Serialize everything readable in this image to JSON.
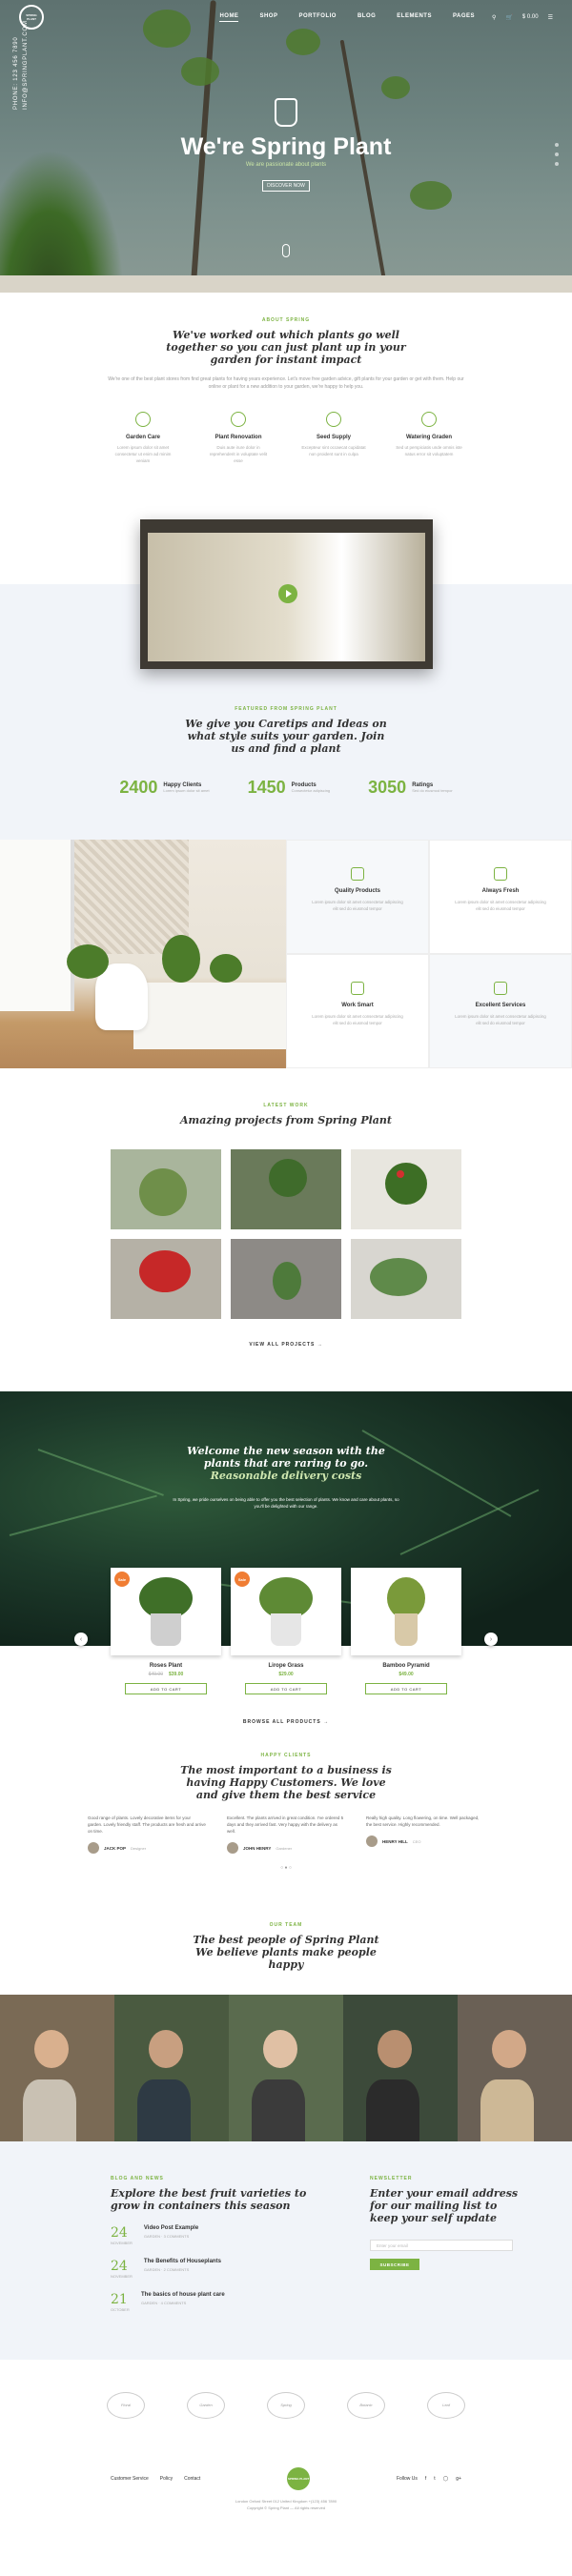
{
  "nav": {
    "logo": "SPRING PLANT",
    "menu": [
      "HOME",
      "SHOP",
      "PORTFOLIO",
      "BLOG",
      "ELEMENTS",
      "PAGES"
    ],
    "cart_label": "$ 0.00",
    "search": "search-icon"
  },
  "hero": {
    "side_phone": "PHONE: 123 456 7890",
    "side_email": "INFO@SPRINGPLANT.COM",
    "title": "We're Spring Plant",
    "subtitle": "We are passionate about plants",
    "button": "DISCOVER NOW"
  },
  "about": {
    "kicker": "ABOUT SPRING",
    "title_line1": "We've worked out which plants go well",
    "title_line2": "together so you can just plant up in your",
    "title_line3": "garden for instant impact",
    "para": "We're one of the best plant stores from find great plants for having years experience. Let's move free garden advice, gift plants for your garden or get with them. Help our online or plant for a new addition to your garden, we're happy to help you.",
    "features": [
      {
        "icon": "leaf-icon",
        "title": "Garden Care",
        "text": "Lorem ipsum dolor sit amet consectetur ut enim ad minim veniam"
      },
      {
        "icon": "plant-icon",
        "title": "Plant Renovation",
        "text": "Duis aute irure dolor in reprehenderit in voluptate velit esse"
      },
      {
        "icon": "seed-icon",
        "title": "Seed Supply",
        "text": "Excepteur sint occaecat cupidatat non proident sunt in culpa"
      },
      {
        "icon": "watering-icon",
        "title": "Watering Graden",
        "text": "Sed ut perspiciatis unde omnis iste natus error sit voluptatem"
      }
    ]
  },
  "stats": {
    "kicker": "FEATURED FROM SPRING PLANT",
    "title_line1": "We give you Caretips and Ideas on",
    "title_line2": "what style suits your garden. Join",
    "title_line3": "us and find a plant",
    "items": [
      {
        "number": "2400",
        "label": "Happy Clients",
        "sub": "Lorem ipsum dolor sit amet"
      },
      {
        "number": "1450",
        "label": "Products",
        "sub": "Consectetur adipiscing"
      },
      {
        "number": "3050",
        "label": "Ratings",
        "sub": "Sed do eiusmod tempor"
      }
    ]
  },
  "quality": [
    {
      "icon": "quality-icon",
      "title": "Quality Products",
      "text": "Lorem ipsum dolor sit amet consectetur adipiscing elit sed do eiusmod tempor"
    },
    {
      "icon": "always-fresh-icon",
      "title": "Always Fresh",
      "text": "Lorem ipsum dolor sit amet consectetur adipiscing elit sed do eiusmod tempor"
    },
    {
      "icon": "work-smart-icon",
      "title": "Work Smart",
      "text": "Lorem ipsum dolor sit amet consectetur adipiscing elit sed do eiusmod tempor"
    },
    {
      "icon": "services-icon",
      "title": "Excellent Services",
      "text": "Lorem ipsum dolor sit amet consectetur adipiscing elit sed do eiusmod tempor"
    }
  ],
  "projects": {
    "kicker": "LATEST WORK",
    "title": "Amazing projects from Spring Plant",
    "view_all": "VIEW ALL PROJECTS"
  },
  "welcome": {
    "title_line1": "Welcome the new season with the",
    "title_line2": "plants that are raring to go.",
    "title_line3": "Reasonable delivery costs",
    "para": "In Spring, we pride ourselves on being able to offer you the best selection of plants. We know and care about plants, so you'll be delighted with our range.",
    "products": [
      {
        "badge": "Sale",
        "name": "Roses Plant",
        "old_price": "$49.00",
        "price": "$39.00",
        "button": "ADD TO CART"
      },
      {
        "badge": "Sale",
        "name": "Lirope Grass",
        "old_price": "",
        "price": "$29.00",
        "button": "ADD TO CART"
      },
      {
        "badge": "",
        "name": "Bamboo Pyramid",
        "old_price": "",
        "price": "$49.00",
        "button": "ADD TO CART"
      }
    ],
    "browse": "BROWSE ALL PRODUCTS"
  },
  "testimonials": {
    "kicker": "HAPPY CLIENTS",
    "title_line1": "The most important to a business is",
    "title_line2": "having Happy Customers. We love",
    "title_line3": "and give them the best service",
    "items": [
      {
        "quote": "Good range of plants. Lovely decorative items for your garden. Lovely friendly staff. The products are fresh and arrive on time.",
        "name": "JACK POP",
        "role": "Designer"
      },
      {
        "quote": "Excellent. The plants arrived in great condition. I've ordered 5 days and they arrived fast. Very happy with the delivery as well.",
        "name": "JOHN HENRY",
        "role": "Gardener"
      },
      {
        "quote": "Really high quality. Long flowering, on time. Well packaged, the best service. Highly recommended.",
        "name": "HENRY HILL",
        "role": "CEO"
      }
    ]
  },
  "team": {
    "kicker": "OUR TEAM",
    "title_line1": "The best people of Spring Plant",
    "title_line2": "We believe plants make people",
    "title_line3": "happy"
  },
  "news": {
    "kicker": "BLOG AND NEWS",
    "title_line1": "Explore the best fruit varieties to",
    "title_line2": "grow in containers this season",
    "items": [
      {
        "day": "24",
        "month": "NOVEMBER",
        "title": "Video Post Example",
        "meta": "GARDEN · 3 COMMENTS"
      },
      {
        "day": "24",
        "month": "NOVEMBER",
        "title": "The Benefits of Houseplants",
        "meta": "GARDEN · 2 COMMENTS"
      },
      {
        "day": "21",
        "month": "OCTOBER",
        "title": "The basics of house plant care",
        "meta": "GARDEN · 4 COMMENTS"
      }
    ]
  },
  "newsletter": {
    "kicker": "NEWSLETTER",
    "title_line1": "Enter your email address",
    "title_line2": "for our mailing list to",
    "title_line3": "keep your self update",
    "placeholder": "Enter your email",
    "button": "SUBSCRIBE"
  },
  "brands": [
    "Floral",
    "Garden",
    "Spring",
    "Botanic",
    "Leaf"
  ],
  "footer": {
    "links": [
      "Customer Service",
      "Policy",
      "Contact"
    ],
    "logo": "SPRING PLANT",
    "follow": "Follow Us",
    "address": "London Oxford Street 012 United Kingdom  +(123) 456 7890",
    "copyright": "Copyright © Spring Plant — All rights reserved"
  }
}
